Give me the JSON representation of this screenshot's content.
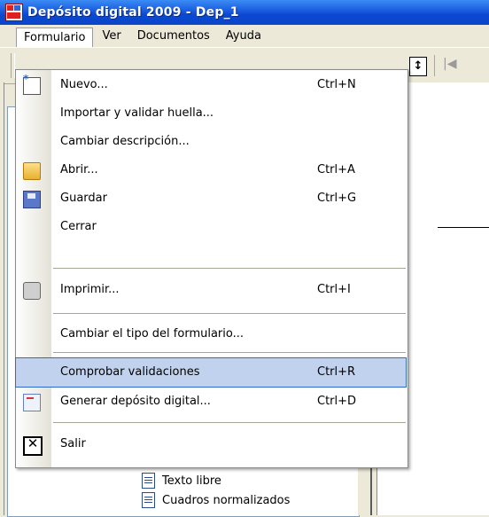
{
  "window": {
    "title": "Depósito digital 2009 - Dep_1"
  },
  "menubar": {
    "items": [
      {
        "label": "Formulario"
      },
      {
        "label": "Ver"
      },
      {
        "label": "Documentos"
      },
      {
        "label": "Ayuda"
      }
    ]
  },
  "dropdown": {
    "items": [
      {
        "label": "Nuevo...",
        "shortcut": "Ctrl+N",
        "icon": "new-document-icon"
      },
      {
        "label": "Importar y validar huella...",
        "shortcut": ""
      },
      {
        "label": "Cambiar descripción...",
        "shortcut": ""
      },
      {
        "label": "Abrir...",
        "shortcut": "Ctrl+A",
        "icon": "folder-icon"
      },
      {
        "label": "Guardar",
        "shortcut": "Ctrl+G",
        "icon": "save-icon"
      },
      {
        "label": "Cerrar",
        "shortcut": ""
      },
      {
        "label": "Imprimir...",
        "shortcut": "Ctrl+I",
        "icon": "printer-icon"
      },
      {
        "label": "Cambiar el tipo del formulario...",
        "shortcut": ""
      },
      {
        "label": "Comprobar validaciones",
        "shortcut": "Ctrl+R"
      },
      {
        "label": "Generar depósito digital...",
        "shortcut": "Ctrl+D",
        "icon": "envelope-icon"
      },
      {
        "label": "Salir",
        "shortcut": "",
        "icon": "close-icon"
      }
    ]
  },
  "tree": {
    "nodes": [
      {
        "label": "Texto libre"
      },
      {
        "label": "Cuadros normalizados"
      }
    ]
  },
  "colors": {
    "titlebar": "#0b46c8",
    "highlight": "#c1d2ee",
    "highlight_border": "#316ac5"
  }
}
